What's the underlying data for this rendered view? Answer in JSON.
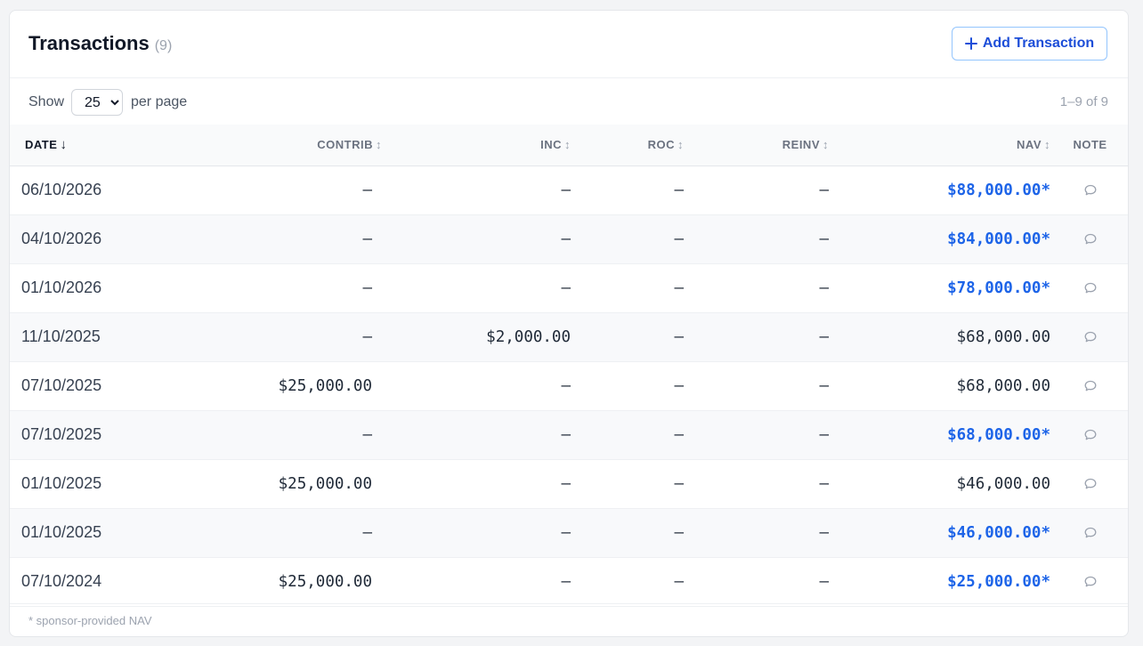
{
  "header": {
    "title": "Transactions",
    "count": "(9)",
    "add_button_label": "Add Transaction"
  },
  "controls": {
    "show_label": "Show",
    "per_page_value": "25",
    "per_page_label": "per page",
    "range_label": "1–9 of 9"
  },
  "columns": [
    {
      "label": "DATE",
      "sort_icon": "↓"
    },
    {
      "label": "CONTRIB",
      "sort_icon": "↕"
    },
    {
      "label": "INC",
      "sort_icon": "↕"
    },
    {
      "label": "ROC",
      "sort_icon": "↕"
    },
    {
      "label": "REINV",
      "sort_icon": "↕"
    },
    {
      "label": "NAV",
      "sort_icon": "↕"
    },
    {
      "label": "NOTE"
    }
  ],
  "rows": [
    {
      "date": "06/10/2026",
      "contrib": "—",
      "inc": "—",
      "roc": "—",
      "reinv": "—",
      "nav": "$88,000.00*",
      "sponsor": true
    },
    {
      "date": "04/10/2026",
      "contrib": "—",
      "inc": "—",
      "roc": "—",
      "reinv": "—",
      "nav": "$84,000.00*",
      "sponsor": true
    },
    {
      "date": "01/10/2026",
      "contrib": "—",
      "inc": "—",
      "roc": "—",
      "reinv": "—",
      "nav": "$78,000.00*",
      "sponsor": true
    },
    {
      "date": "11/10/2025",
      "contrib": "—",
      "inc": "$2,000.00",
      "roc": "—",
      "reinv": "—",
      "nav": "$68,000.00",
      "sponsor": false
    },
    {
      "date": "07/10/2025",
      "contrib": "$25,000.00",
      "inc": "—",
      "roc": "—",
      "reinv": "—",
      "nav": "$68,000.00",
      "sponsor": false
    },
    {
      "date": "07/10/2025",
      "contrib": "—",
      "inc": "—",
      "roc": "—",
      "reinv": "—",
      "nav": "$68,000.00*",
      "sponsor": true
    },
    {
      "date": "01/10/2025",
      "contrib": "$25,000.00",
      "inc": "—",
      "roc": "—",
      "reinv": "—",
      "nav": "$46,000.00",
      "sponsor": false
    },
    {
      "date": "01/10/2025",
      "contrib": "—",
      "inc": "—",
      "roc": "—",
      "reinv": "—",
      "nav": "$46,000.00*",
      "sponsor": true
    },
    {
      "date": "07/10/2024",
      "contrib": "$25,000.00",
      "inc": "—",
      "roc": "—",
      "reinv": "—",
      "nav": "$25,000.00*",
      "sponsor": true
    }
  ],
  "footnote": "* sponsor-provided NAV",
  "icons": {
    "add": "plus-icon",
    "note": "speech-bubble-icon",
    "sort": "sort-arrows-icon"
  },
  "colors": {
    "accent": "#1d4ed8",
    "sponsor_nav": "#1d64e8",
    "muted": "#9ca3af"
  }
}
